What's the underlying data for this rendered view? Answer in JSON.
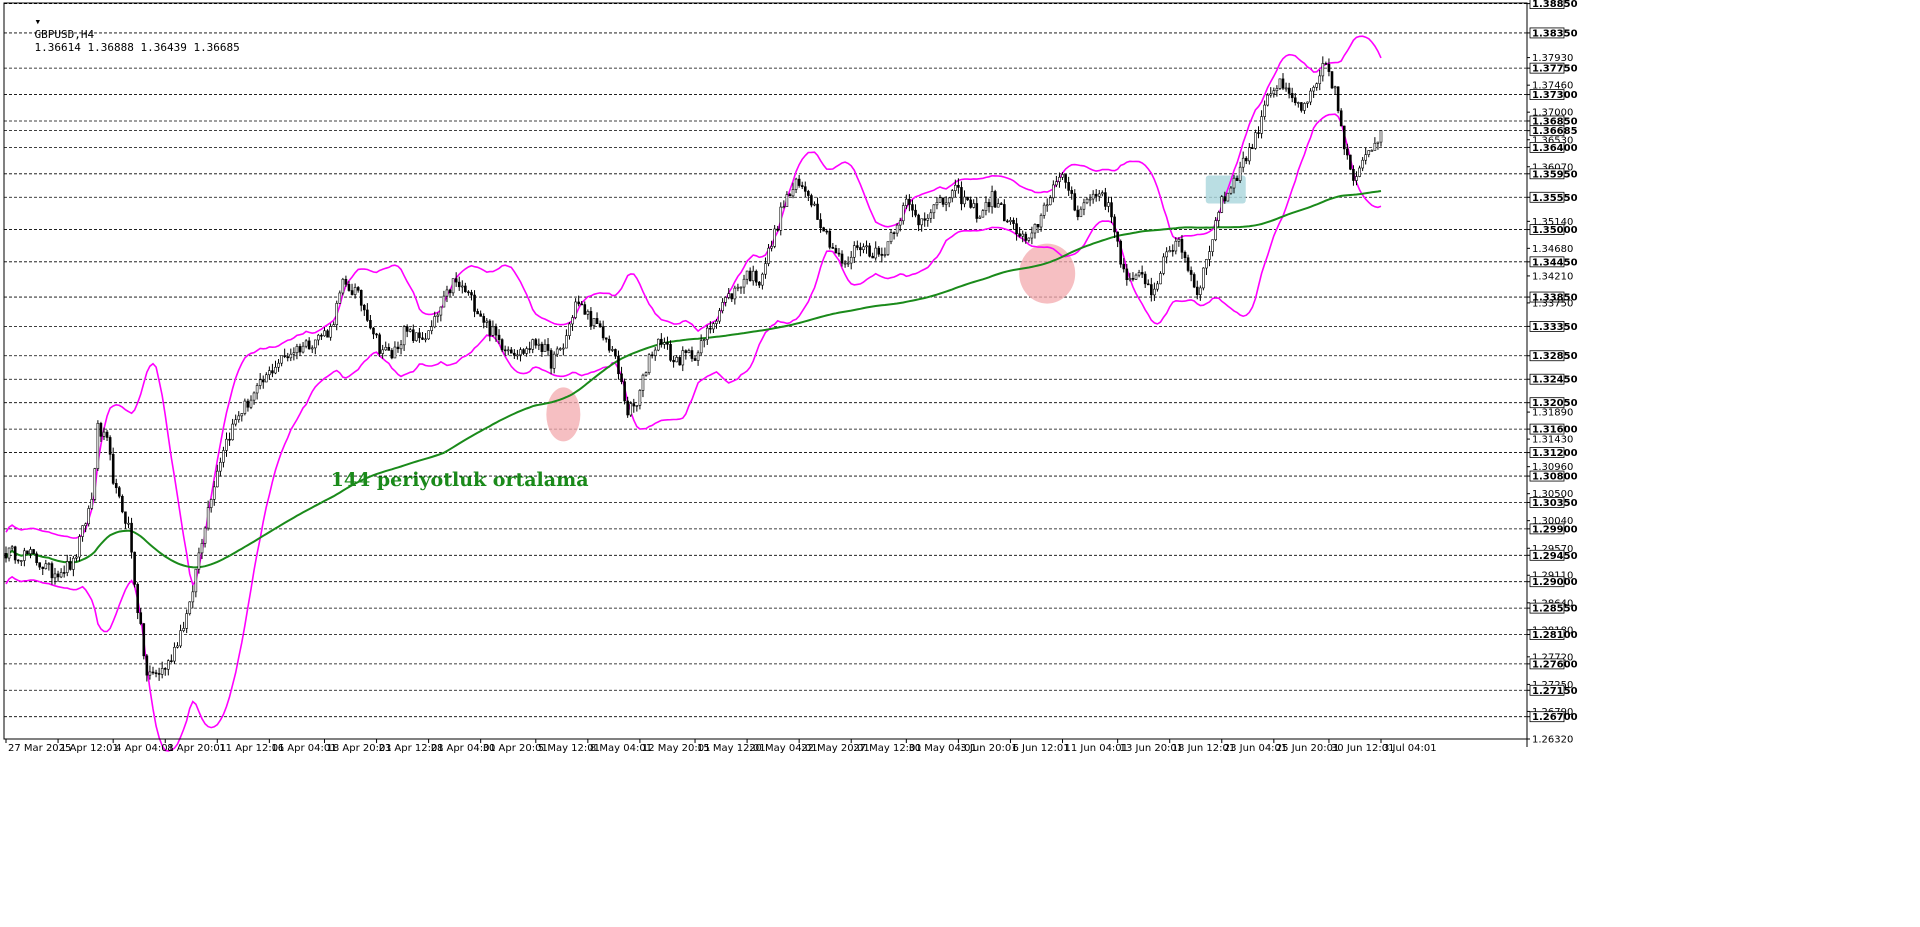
{
  "header": {
    "symbol": "GBPUSD,H4",
    "ohlc": "1.36614 1.36888 1.36439 1.36685"
  },
  "chart_data": {
    "type": "candlestick",
    "title": "GBPUSD,H4",
    "grid": "horizontal dashed",
    "ylim": [
      1.2632,
      1.3886
    ],
    "y_ticks": [
      "1.38850",
      "1.38350",
      "1.37930",
      "1.37750",
      "1.37460",
      "1.37300",
      "1.37000",
      "1.36850",
      "1.36685",
      "1.36530",
      "1.36400",
      "1.36070",
      "1.35950",
      "1.35550",
      "1.35140",
      "1.35000",
      "1.34680",
      "1.34450",
      "1.34210",
      "1.33850",
      "1.33750",
      "1.33350",
      "1.32850",
      "1.32450",
      "1.32050",
      "1.31890",
      "1.31600",
      "1.31430",
      "1.31200",
      "1.30960",
      "1.30800",
      "1.30500",
      "1.30350",
      "1.30040",
      "1.29900",
      "1.29570",
      "1.29450",
      "1.29110",
      "1.29000",
      "1.28640",
      "1.28550",
      "1.28180",
      "1.28100",
      "1.27720",
      "1.27600",
      "1.27250",
      "1.27150",
      "1.26790",
      "1.26700",
      "1.26320"
    ],
    "y_ticks_highlighted": [
      "1.38850",
      "1.38350",
      "1.37750",
      "1.37300",
      "1.36850",
      "1.36685",
      "1.36400",
      "1.35950",
      "1.35550",
      "1.35000",
      "1.34450",
      "1.33850",
      "1.33350",
      "1.32850",
      "1.32450",
      "1.32050",
      "1.31600",
      "1.31200",
      "1.30800",
      "1.30350",
      "1.29900",
      "1.29450",
      "1.29000",
      "1.28550",
      "1.28100",
      "1.27600",
      "1.27150",
      "1.26700"
    ],
    "x_ticks": [
      "27 Mar 2025",
      "1 Apr 12:01",
      "4 Apr 04:01",
      "8 Apr 20:01",
      "11 Apr 12:01",
      "16 Apr 04:01",
      "18 Apr 20:01",
      "23 Apr 12:01",
      "28 Apr 04:01",
      "30 Apr 20:01",
      "5 May 12:01",
      "8 May 04:01",
      "12 May 20:01",
      "15 May 12:01",
      "20 May 04:01",
      "22 May 20:01",
      "27 May 12:01",
      "30 May 04:01",
      "3 Jun 20:01",
      "6 Jun 12:01",
      "11 Jun 04:01",
      "13 Jun 20:01",
      "18 Jun 12:01",
      "23 Jun 04:01",
      "25 Jun 20:01",
      "30 Jun 12:01",
      "3 Jul 04:01"
    ],
    "price_anchors": [
      [
        0,
        1.295
      ],
      [
        8,
        1.2945
      ],
      [
        15,
        1.2915
      ],
      [
        22,
        1.293
      ],
      [
        28,
        1.304
      ],
      [
        30,
        1.316
      ],
      [
        33,
        1.3135
      ],
      [
        36,
        1.305
      ],
      [
        40,
        1.2995
      ],
      [
        43,
        1.2855
      ],
      [
        46,
        1.274
      ],
      [
        50,
        1.2745
      ],
      [
        53,
        1.276
      ],
      [
        57,
        1.2815
      ],
      [
        60,
        1.2855
      ],
      [
        63,
        1.295
      ],
      [
        67,
        1.305
      ],
      [
        71,
        1.313
      ],
      [
        76,
        1.3185
      ],
      [
        82,
        1.3225
      ],
      [
        88,
        1.327
      ],
      [
        94,
        1.3295
      ],
      [
        100,
        1.331
      ],
      [
        106,
        1.333
      ],
      [
        110,
        1.3405
      ],
      [
        114,
        1.3395
      ],
      [
        118,
        1.3355
      ],
      [
        122,
        1.33
      ],
      [
        126,
        1.3285
      ],
      [
        130,
        1.3325
      ],
      [
        134,
        1.3315
      ],
      [
        138,
        1.332
      ],
      [
        142,
        1.3365
      ],
      [
        146,
        1.341
      ],
      [
        150,
        1.3395
      ],
      [
        154,
        1.3365
      ],
      [
        158,
        1.333
      ],
      [
        162,
        1.3305
      ],
      [
        168,
        1.329
      ],
      [
        174,
        1.331
      ],
      [
        178,
        1.3275
      ],
      [
        182,
        1.33
      ],
      [
        186,
        1.3375
      ],
      [
        190,
        1.3355
      ],
      [
        194,
        1.3325
      ],
      [
        198,
        1.3295
      ],
      [
        201,
        1.3235
      ],
      [
        203,
        1.319
      ],
      [
        206,
        1.32
      ],
      [
        210,
        1.3285
      ],
      [
        214,
        1.3315
      ],
      [
        218,
        1.3275
      ],
      [
        222,
        1.3285
      ],
      [
        226,
        1.329
      ],
      [
        230,
        1.3335
      ],
      [
        234,
        1.3375
      ],
      [
        238,
        1.3395
      ],
      [
        242,
        1.3425
      ],
      [
        246,
        1.3415
      ],
      [
        250,
        1.3475
      ],
      [
        254,
        1.3545
      ],
      [
        258,
        1.3575
      ],
      [
        262,
        1.3565
      ],
      [
        266,
        1.3515
      ],
      [
        270,
        1.347
      ],
      [
        274,
        1.3435
      ],
      [
        278,
        1.3475
      ],
      [
        282,
        1.3465
      ],
      [
        286,
        1.3455
      ],
      [
        290,
        1.3505
      ],
      [
        294,
        1.3545
      ],
      [
        298,
        1.3515
      ],
      [
        302,
        1.3535
      ],
      [
        306,
        1.3545
      ],
      [
        310,
        1.3565
      ],
      [
        314,
        1.3545
      ],
      [
        318,
        1.3525
      ],
      [
        322,
        1.3555
      ],
      [
        326,
        1.3525
      ],
      [
        330,
        1.3495
      ],
      [
        334,
        1.3475
      ],
      [
        338,
        1.3525
      ],
      [
        342,
        1.3575
      ],
      [
        346,
        1.3585
      ],
      [
        350,
        1.353
      ],
      [
        354,
        1.3555
      ],
      [
        358,
        1.3565
      ],
      [
        362,
        1.3505
      ],
      [
        365,
        1.3425
      ],
      [
        368,
        1.3405
      ],
      [
        371,
        1.343
      ],
      [
        374,
        1.339
      ],
      [
        377,
        1.343
      ],
      [
        380,
        1.3465
      ],
      [
        383,
        1.3485
      ],
      [
        386,
        1.3435
      ],
      [
        389,
        1.3395
      ],
      [
        392,
        1.3445
      ],
      [
        396,
        1.3535
      ],
      [
        400,
        1.3575
      ],
      [
        404,
        1.3615
      ],
      [
        408,
        1.3655
      ],
      [
        412,
        1.3735
      ],
      [
        416,
        1.3745
      ],
      [
        420,
        1.372
      ],
      [
        424,
        1.3705
      ],
      [
        428,
        1.3745
      ],
      [
        431,
        1.3785
      ],
      [
        434,
        1.3735
      ],
      [
        437,
        1.364
      ],
      [
        440,
        1.3575
      ],
      [
        443,
        1.3625
      ],
      [
        446,
        1.3645
      ],
      [
        449,
        1.3668
      ]
    ],
    "series": [
      {
        "kind": "candles",
        "name": "GBPUSD,H4",
        "count": 450,
        "color": "#000000"
      },
      {
        "kind": "line",
        "name": "144 periyotluk ortalama",
        "period": 144,
        "color": "#1a8a1a"
      },
      {
        "kind": "envelope",
        "name": "bands",
        "color": "#ff00ff"
      }
    ],
    "annotations": [
      {
        "text": "144 periyotluk ortalama",
        "x_index": 106,
        "y": 1.3063,
        "color": "#1a8a1a"
      },
      {
        "shape": "circle",
        "x_index": 182,
        "y": 1.3185,
        "color": "#f3a9ae"
      },
      {
        "shape": "circle",
        "x_index": 340,
        "y": 1.3425,
        "color": "#f3a9ae"
      },
      {
        "shape": "rect",
        "x_index": 397,
        "y": 1.3575,
        "color": "#a9d6dc"
      }
    ],
    "colors": {
      "candles": "#000000",
      "ma": "#1a8a1a",
      "bands": "#ff00ff",
      "grid": "#000000",
      "marker_red": "#f3a9ae",
      "marker_blue": "#a9d6dc"
    }
  }
}
